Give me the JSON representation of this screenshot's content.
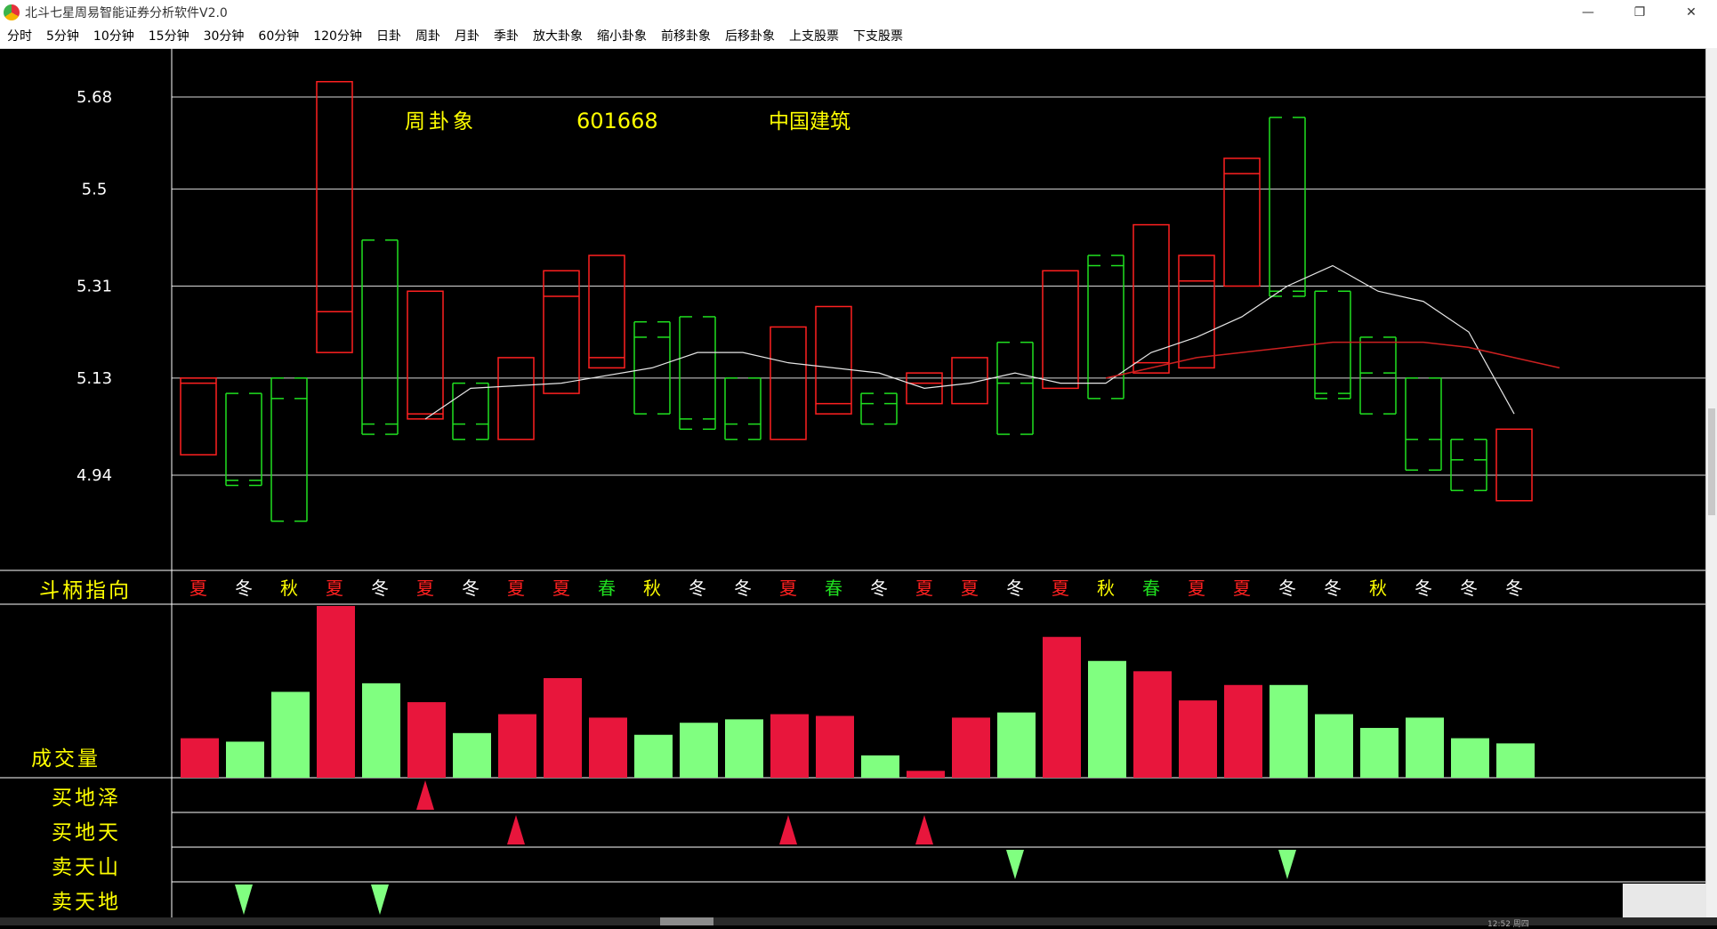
{
  "window": {
    "title": "北斗七星周易智能证券分析软件V2.0",
    "controls": [
      "—",
      "❐",
      "✕"
    ]
  },
  "menu": [
    "分时",
    "5分钟",
    "10分钟",
    "15分钟",
    "30分钟",
    "60分钟",
    "120分钟",
    "日卦",
    "周卦",
    "月卦",
    "季卦",
    "放大卦象",
    "缩小卦象",
    "前移卦象",
    "后移卦象",
    "上支股票",
    "下支股票"
  ],
  "chart": {
    "period_label": "周卦象",
    "stock_code": "601668",
    "stock_name": "中国建筑",
    "y_ticks": [
      "5.68",
      "5.5",
      "5.31",
      "5.13",
      "4.94"
    ],
    "y_tick_values": [
      5.68,
      5.5,
      5.31,
      5.13,
      4.94
    ],
    "section_labels": {
      "direction": "斗柄指向",
      "volume": "成交量"
    },
    "signal_rows": [
      "买地泽",
      "买地天",
      "卖天山",
      "卖天地"
    ],
    "colors": {
      "red": "#ff2020",
      "green": "#20e020",
      "yellow": "#ffff00",
      "volume_red": "#e8163c",
      "volume_green": "#80ff80",
      "ma_white": "#e6e6e6",
      "ma_red": "#cc2020",
      "grid": "#ffffff"
    },
    "season_colors": {
      "夏": "#ff2020",
      "冬": "#ffffff",
      "秋": "#ffff00",
      "春": "#20e020"
    },
    "candles": [
      {
        "c": "red",
        "top": 5.13,
        "bot": 4.98,
        "mid": [
          5.12
        ]
      },
      {
        "c": "green",
        "top": 5.1,
        "bot": 4.92,
        "mid": [
          4.93
        ]
      },
      {
        "c": "green",
        "top": 5.13,
        "bot": 4.85,
        "mid": [
          5.09
        ]
      },
      {
        "c": "red",
        "top": 5.71,
        "bot": 5.18,
        "mid": [
          5.26
        ]
      },
      {
        "c": "green",
        "top": 5.4,
        "bot": 5.02,
        "mid": [
          5.04
        ]
      },
      {
        "c": "red",
        "top": 5.3,
        "bot": 5.05,
        "mid": [
          5.06
        ]
      },
      {
        "c": "green",
        "top": 5.12,
        "bot": 5.01,
        "mid": [
          5.04
        ]
      },
      {
        "c": "red",
        "top": 5.17,
        "bot": 5.01,
        "mid": []
      },
      {
        "c": "red",
        "top": 5.34,
        "bot": 5.1,
        "mid": [
          5.29
        ]
      },
      {
        "c": "red",
        "top": 5.37,
        "bot": 5.15,
        "mid": [
          5.17
        ]
      },
      {
        "c": "green",
        "top": 5.24,
        "bot": 5.06,
        "mid": [
          5.21
        ]
      },
      {
        "c": "green",
        "top": 5.25,
        "bot": 5.03,
        "mid": [
          5.05
        ]
      },
      {
        "c": "green",
        "top": 5.13,
        "bot": 5.01,
        "mid": [
          5.04
        ]
      },
      {
        "c": "red",
        "top": 5.23,
        "bot": 5.01,
        "mid": []
      },
      {
        "c": "red",
        "top": 5.27,
        "bot": 5.06,
        "mid": [
          5.08
        ]
      },
      {
        "c": "green",
        "top": 5.1,
        "bot": 5.04,
        "mid": [
          5.08
        ]
      },
      {
        "c": "red",
        "top": 5.14,
        "bot": 5.08,
        "mid": [
          5.12
        ]
      },
      {
        "c": "red",
        "top": 5.17,
        "bot": 5.08,
        "mid": []
      },
      {
        "c": "green",
        "top": 5.2,
        "bot": 5.02,
        "mid": [
          5.12
        ]
      },
      {
        "c": "red",
        "top": 5.34,
        "bot": 5.11,
        "mid": []
      },
      {
        "c": "green",
        "top": 5.37,
        "bot": 5.09,
        "mid": [
          5.35
        ]
      },
      {
        "c": "red",
        "top": 5.43,
        "bot": 5.14,
        "mid": [
          5.16
        ]
      },
      {
        "c": "red",
        "top": 5.37,
        "bot": 5.15,
        "mid": [
          5.32
        ]
      },
      {
        "c": "red",
        "top": 5.56,
        "bot": 5.31,
        "mid": [
          5.53
        ]
      },
      {
        "c": "green",
        "top": 5.64,
        "bot": 5.29,
        "mid": [
          5.3
        ]
      },
      {
        "c": "green",
        "top": 5.3,
        "bot": 5.09,
        "mid": [
          5.1
        ]
      },
      {
        "c": "green",
        "top": 5.21,
        "bot": 5.06,
        "mid": [
          5.14
        ]
      },
      {
        "c": "green",
        "top": 5.13,
        "bot": 4.95,
        "mid": [
          5.01
        ]
      },
      {
        "c": "green",
        "top": 5.01,
        "bot": 4.91,
        "mid": [
          4.97
        ]
      },
      {
        "c": "red",
        "top": 5.03,
        "bot": 4.89,
        "mid": []
      }
    ],
    "ma_white": [
      [
        5,
        5.05
      ],
      [
        6,
        5.11
      ],
      [
        8,
        5.12
      ],
      [
        10,
        5.15
      ],
      [
        11,
        5.18
      ],
      [
        12,
        5.18
      ],
      [
        13,
        5.16
      ],
      [
        15,
        5.14
      ],
      [
        16,
        5.11
      ],
      [
        17,
        5.12
      ],
      [
        18,
        5.14
      ],
      [
        19,
        5.12
      ],
      [
        20,
        5.12
      ],
      [
        21,
        5.18
      ],
      [
        22,
        5.21
      ],
      [
        23,
        5.25
      ],
      [
        24,
        5.31
      ],
      [
        25,
        5.35
      ],
      [
        26,
        5.3
      ],
      [
        27,
        5.28
      ],
      [
        28,
        5.22
      ],
      [
        29,
        5.06
      ]
    ],
    "ma_red": [
      [
        20,
        5.13
      ],
      [
        21,
        5.15
      ],
      [
        22,
        5.17
      ],
      [
        23,
        5.18
      ],
      [
        24,
        5.19
      ],
      [
        25,
        5.2
      ],
      [
        26,
        5.2
      ],
      [
        27,
        5.2
      ],
      [
        28,
        5.19
      ],
      [
        29,
        5.17
      ],
      [
        30,
        5.15
      ]
    ],
    "seasons": [
      "夏",
      "冬",
      "秋",
      "夏",
      "冬",
      "夏",
      "冬",
      "夏",
      "夏",
      "春",
      "秋",
      "冬",
      "冬",
      "夏",
      "春",
      "冬",
      "夏",
      "夏",
      "冬",
      "夏",
      "秋",
      "春",
      "夏",
      "夏",
      "冬",
      "冬",
      "秋",
      "冬",
      "冬",
      "冬"
    ],
    "volumes": [
      {
        "c": "red",
        "v": 23
      },
      {
        "c": "green",
        "v": 21
      },
      {
        "c": "green",
        "v": 50
      },
      {
        "c": "red",
        "v": 100
      },
      {
        "c": "green",
        "v": 55
      },
      {
        "c": "red",
        "v": 44
      },
      {
        "c": "green",
        "v": 26
      },
      {
        "c": "red",
        "v": 37
      },
      {
        "c": "red",
        "v": 58
      },
      {
        "c": "red",
        "v": 35
      },
      {
        "c": "green",
        "v": 25
      },
      {
        "c": "green",
        "v": 32
      },
      {
        "c": "green",
        "v": 34
      },
      {
        "c": "red",
        "v": 37
      },
      {
        "c": "red",
        "v": 36
      },
      {
        "c": "green",
        "v": 13
      },
      {
        "c": "red",
        "v": 4
      },
      {
        "c": "red",
        "v": 35
      },
      {
        "c": "green",
        "v": 38
      },
      {
        "c": "red",
        "v": 82
      },
      {
        "c": "green",
        "v": 68
      },
      {
        "c": "red",
        "v": 62
      },
      {
        "c": "red",
        "v": 45
      },
      {
        "c": "red",
        "v": 54
      },
      {
        "c": "green",
        "v": 54
      },
      {
        "c": "green",
        "v": 37
      },
      {
        "c": "green",
        "v": 29
      },
      {
        "c": "green",
        "v": 35
      },
      {
        "c": "green",
        "v": 23
      },
      {
        "c": "green",
        "v": 20
      }
    ],
    "signals": [
      {
        "row": 0,
        "i": 5,
        "dir": "up",
        "c": "red"
      },
      {
        "row": 1,
        "i": 7,
        "dir": "up",
        "c": "red"
      },
      {
        "row": 1,
        "i": 13,
        "dir": "up",
        "c": "red"
      },
      {
        "row": 1,
        "i": 16,
        "dir": "up",
        "c": "red"
      },
      {
        "row": 2,
        "i": 18,
        "dir": "down",
        "c": "green"
      },
      {
        "row": 2,
        "i": 24,
        "dir": "down",
        "c": "green"
      },
      {
        "row": 3,
        "i": 1,
        "dir": "down",
        "c": "green"
      },
      {
        "row": 3,
        "i": 4,
        "dir": "down",
        "c": "green"
      }
    ]
  },
  "status": {
    "time": "12:52 周四"
  }
}
